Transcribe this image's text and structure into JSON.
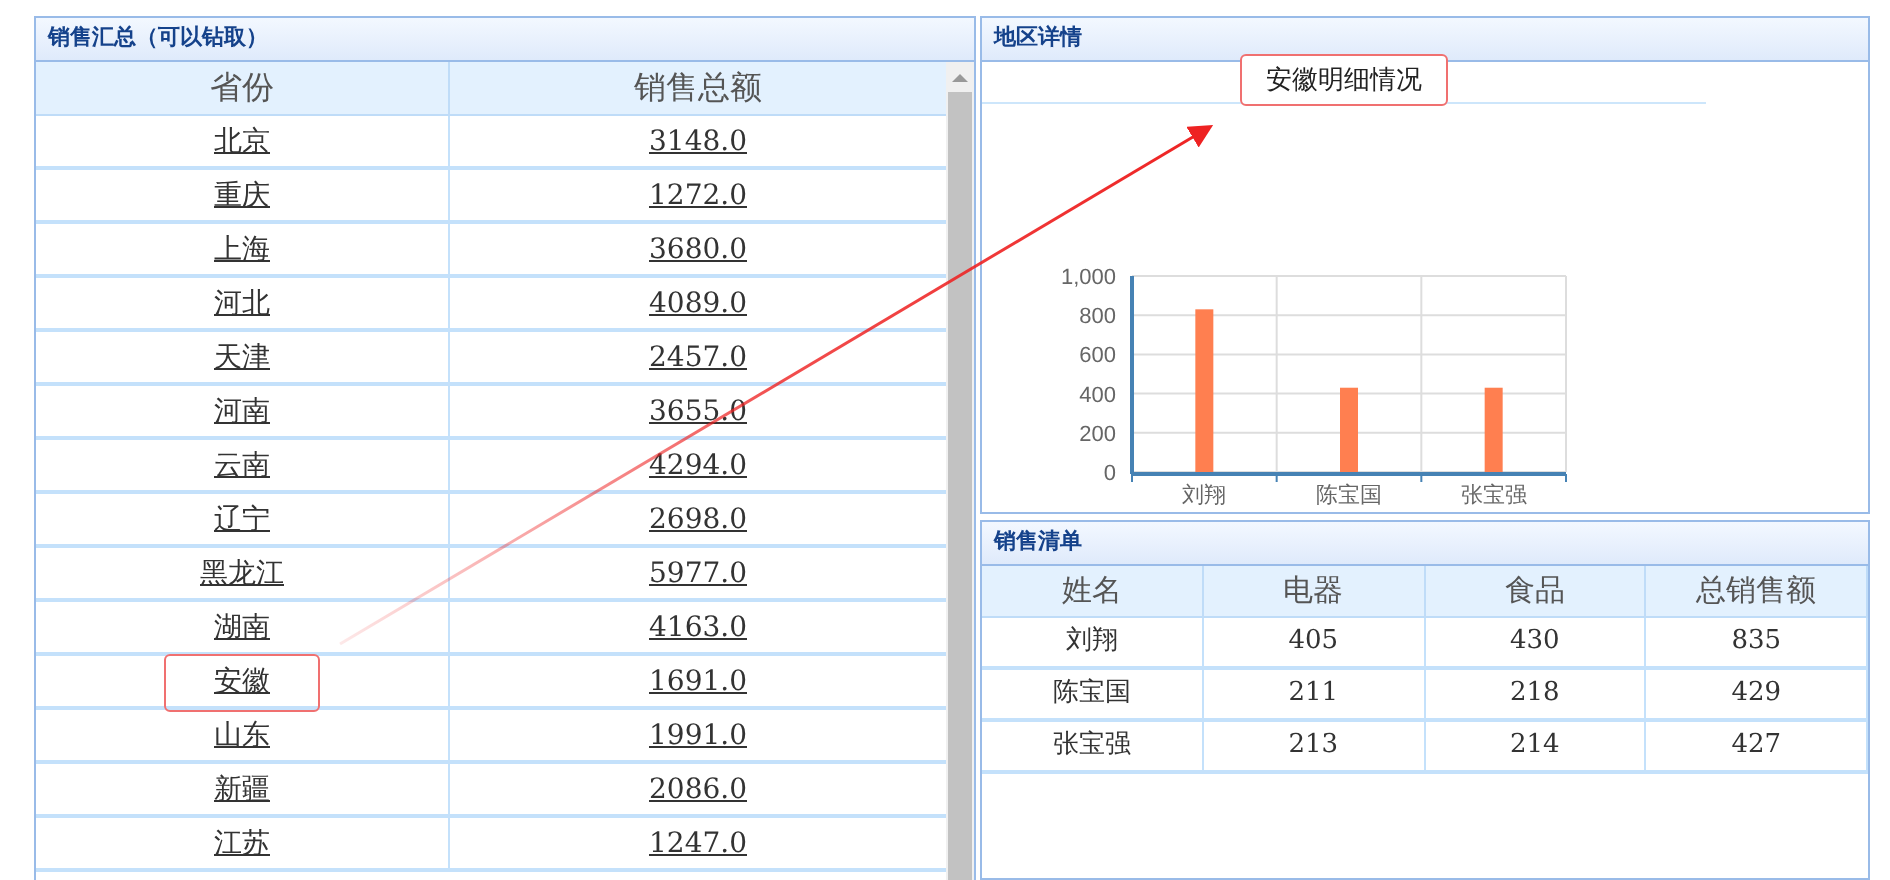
{
  "summary_panel": {
    "title": "销售汇总（可以钻取）",
    "columns": [
      "省份",
      "销售总额"
    ],
    "rows": [
      {
        "province": "北京",
        "total": "3148.0",
        "marked": false
      },
      {
        "province": "重庆",
        "total": "1272.0",
        "marked": false
      },
      {
        "province": "上海",
        "total": "3680.0",
        "marked": false
      },
      {
        "province": "河北",
        "total": "4089.0",
        "marked": false
      },
      {
        "province": "天津",
        "total": "2457.0",
        "marked": false
      },
      {
        "province": "河南",
        "total": "3655.0",
        "marked": false
      },
      {
        "province": "云南",
        "total": "4294.0",
        "marked": false
      },
      {
        "province": "辽宁",
        "total": "2698.0",
        "marked": false
      },
      {
        "province": "黑龙江",
        "total": "5977.0",
        "marked": false
      },
      {
        "province": "湖南",
        "total": "4163.0",
        "marked": false
      },
      {
        "province": "安徽",
        "total": "1691.0",
        "marked": true
      },
      {
        "province": "山东",
        "total": "1991.0",
        "marked": false
      },
      {
        "province": "新疆",
        "total": "2086.0",
        "marked": false
      },
      {
        "province": "江苏",
        "total": "1247.0",
        "marked": false
      }
    ]
  },
  "detail_panel": {
    "title": "地区详情",
    "chart_title": "安徽明细情况",
    "chart_title_marked": true,
    "chart_data": {
      "type": "bar",
      "categories": [
        "刘翔",
        "陈宝国",
        "张宝强"
      ],
      "series": [
        {
          "color": "#ff7f50",
          "values": [
            830,
            430,
            430
          ]
        }
      ],
      "grid": true,
      "ylim": [
        0,
        1000
      ],
      "yticks": [
        0,
        200,
        400,
        600,
        800,
        {
          "value": 1000,
          "label": "1,000"
        }
      ]
    }
  },
  "list_panel": {
    "title": "销售清单",
    "columns": [
      "姓名",
      "电器",
      "食品",
      "总销售额"
    ],
    "rows": [
      [
        "刘翔",
        "405",
        "430",
        "835"
      ],
      [
        "陈宝国",
        "211",
        "218",
        "429"
      ],
      [
        "张宝强",
        "213",
        "214",
        "427"
      ]
    ]
  }
}
